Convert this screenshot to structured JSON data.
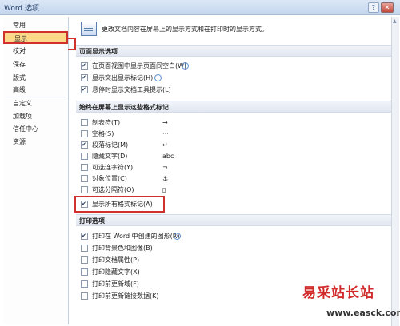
{
  "window": {
    "title": "Word 选项",
    "help": "?",
    "close": "✕"
  },
  "sidebar": {
    "items": [
      {
        "label": "常用"
      },
      {
        "label": "显示"
      },
      {
        "label": "校对"
      },
      {
        "label": "保存"
      },
      {
        "label": "版式"
      },
      {
        "label": "高级"
      },
      {
        "label": "自定义"
      },
      {
        "label": "加载项"
      },
      {
        "label": "信任中心"
      },
      {
        "label": "资源"
      }
    ],
    "active": "显示"
  },
  "banner": {
    "text": "更改文档内容在屏幕上的显示方式和在打印时的显示方式。"
  },
  "page_display": {
    "header": "页面显示选项",
    "options": [
      {
        "label": "在页面视图中显示页面间空白(W)",
        "checked": true,
        "info": true
      },
      {
        "label": "显示突出显示标记(H)",
        "checked": true,
        "info": true
      },
      {
        "label": "悬停时显示文档工具提示(L)",
        "checked": true,
        "info": false
      }
    ]
  },
  "formatting_marks": {
    "header": "始终在屏幕上显示这些格式标记",
    "options": [
      {
        "label": "制表符(T)",
        "checked": false,
        "symbol": "→"
      },
      {
        "label": "空格(S)",
        "checked": false,
        "symbol": "···"
      },
      {
        "label": "段落标记(M)",
        "checked": true,
        "symbol": "↵"
      },
      {
        "label": "隐藏文字(D)",
        "checked": false,
        "symbol": "abc"
      },
      {
        "label": "可选连字符(Y)",
        "checked": false,
        "symbol": "¬"
      },
      {
        "label": "对象位置(C)",
        "checked": false,
        "symbol": "⚓"
      },
      {
        "label": "可选分隔符(O)",
        "checked": false,
        "symbol": "▯"
      },
      {
        "label": "显示所有格式标记(A)",
        "checked": true,
        "symbol": ""
      }
    ]
  },
  "print_options": {
    "header": "打印选项",
    "options": [
      {
        "label": "打印在 Word 中创建的图形(R)",
        "checked": true,
        "info": true
      },
      {
        "label": "打印背景色和图像(B)",
        "checked": false,
        "info": false
      },
      {
        "label": "打印文档属性(P)",
        "checked": false,
        "info": false
      },
      {
        "label": "打印隐藏文字(X)",
        "checked": false,
        "info": false
      },
      {
        "label": "打印前更新域(F)",
        "checked": false,
        "info": false
      },
      {
        "label": "打印前更新链接数据(K)",
        "checked": false,
        "info": false
      }
    ]
  },
  "watermark": {
    "name": "易采站长站",
    "url": "www.easck.com"
  },
  "colors": {
    "accent": "#fbd88a",
    "highlight_border": "#d0312d",
    "section_bg": "#e1e7f0"
  }
}
